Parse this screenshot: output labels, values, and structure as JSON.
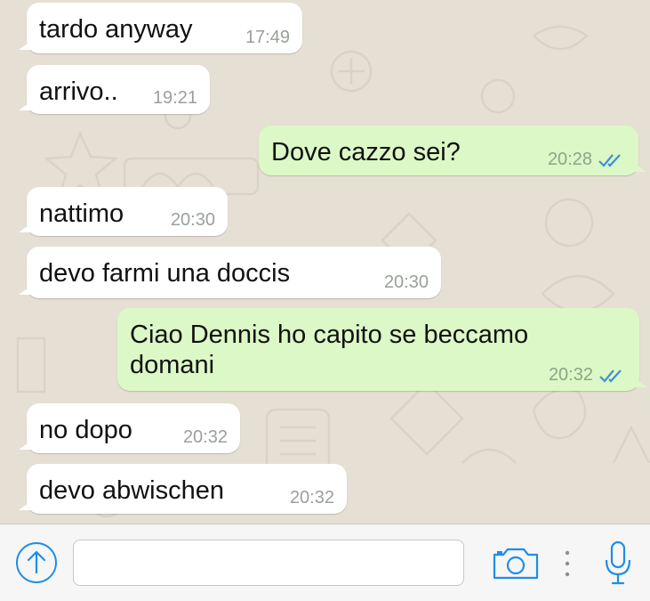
{
  "messages": [
    {
      "direction": "incoming",
      "text": "tardo anyway",
      "time": "17:49"
    },
    {
      "direction": "incoming",
      "text": "arrivo..",
      "time": "19:21"
    },
    {
      "direction": "outgoing",
      "text": "Dove cazzo sei?",
      "time": "20:28",
      "status": "read"
    },
    {
      "direction": "incoming",
      "text": "nattimo",
      "time": "20:30"
    },
    {
      "direction": "incoming",
      "text": "devo farmi una doccis",
      "time": "20:30"
    },
    {
      "direction": "outgoing",
      "text": "Ciao Dennis ho capito se beccamo\ndomani",
      "time": "20:32",
      "status": "read"
    },
    {
      "direction": "incoming",
      "text": "no dopo",
      "time": "20:32"
    },
    {
      "direction": "incoming",
      "text": "devo abwischen",
      "time": "20:32"
    }
  ],
  "input_bar": {
    "message_value": "",
    "icons": [
      "share-up-arrow-icon",
      "camera-icon",
      "more-dots-icon",
      "microphone-icon"
    ]
  },
  "colors": {
    "accent": "#1e8ee6",
    "incoming_bubble": "#ffffff",
    "outgoing_bubble": "#dcf8c6",
    "read_ticks": "#3c91d4",
    "wallpaper": "#e6dfd4"
  }
}
